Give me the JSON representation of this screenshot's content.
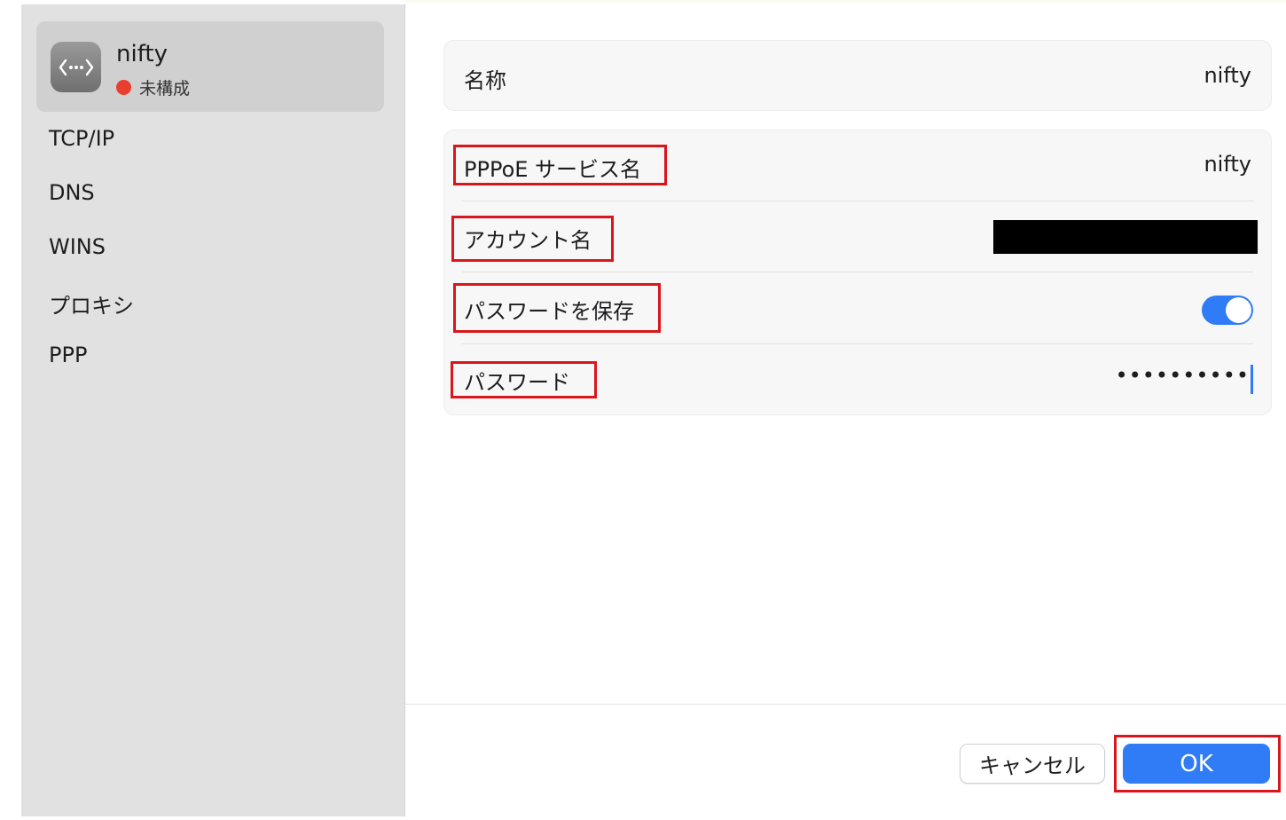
{
  "sidebar": {
    "service": {
      "name": "nifty",
      "status": "未構成",
      "status_color": "#eb3c30",
      "icon": "network-service-icon"
    },
    "items": [
      {
        "label": "TCP/IP"
      },
      {
        "label": "DNS"
      },
      {
        "label": "WINS"
      },
      {
        "label": "プロキシ"
      },
      {
        "label": "PPP"
      }
    ]
  },
  "main": {
    "name_row": {
      "label": "名称",
      "value": "nifty"
    },
    "pppoe": {
      "service_label": "PPPoE サービス名",
      "service_value": "nifty",
      "account_label": "アカウント名",
      "save_password_label": "パスワードを保存",
      "save_password_on": true,
      "password_label": "パスワード",
      "password_value": "••••••••••"
    }
  },
  "footer": {
    "cancel_label": "キャンセル",
    "ok_label": "OK"
  },
  "colors": {
    "accent": "#2f7cf6",
    "highlight_box": "#d9161c",
    "sidebar_bg": "#e1e1e1"
  }
}
